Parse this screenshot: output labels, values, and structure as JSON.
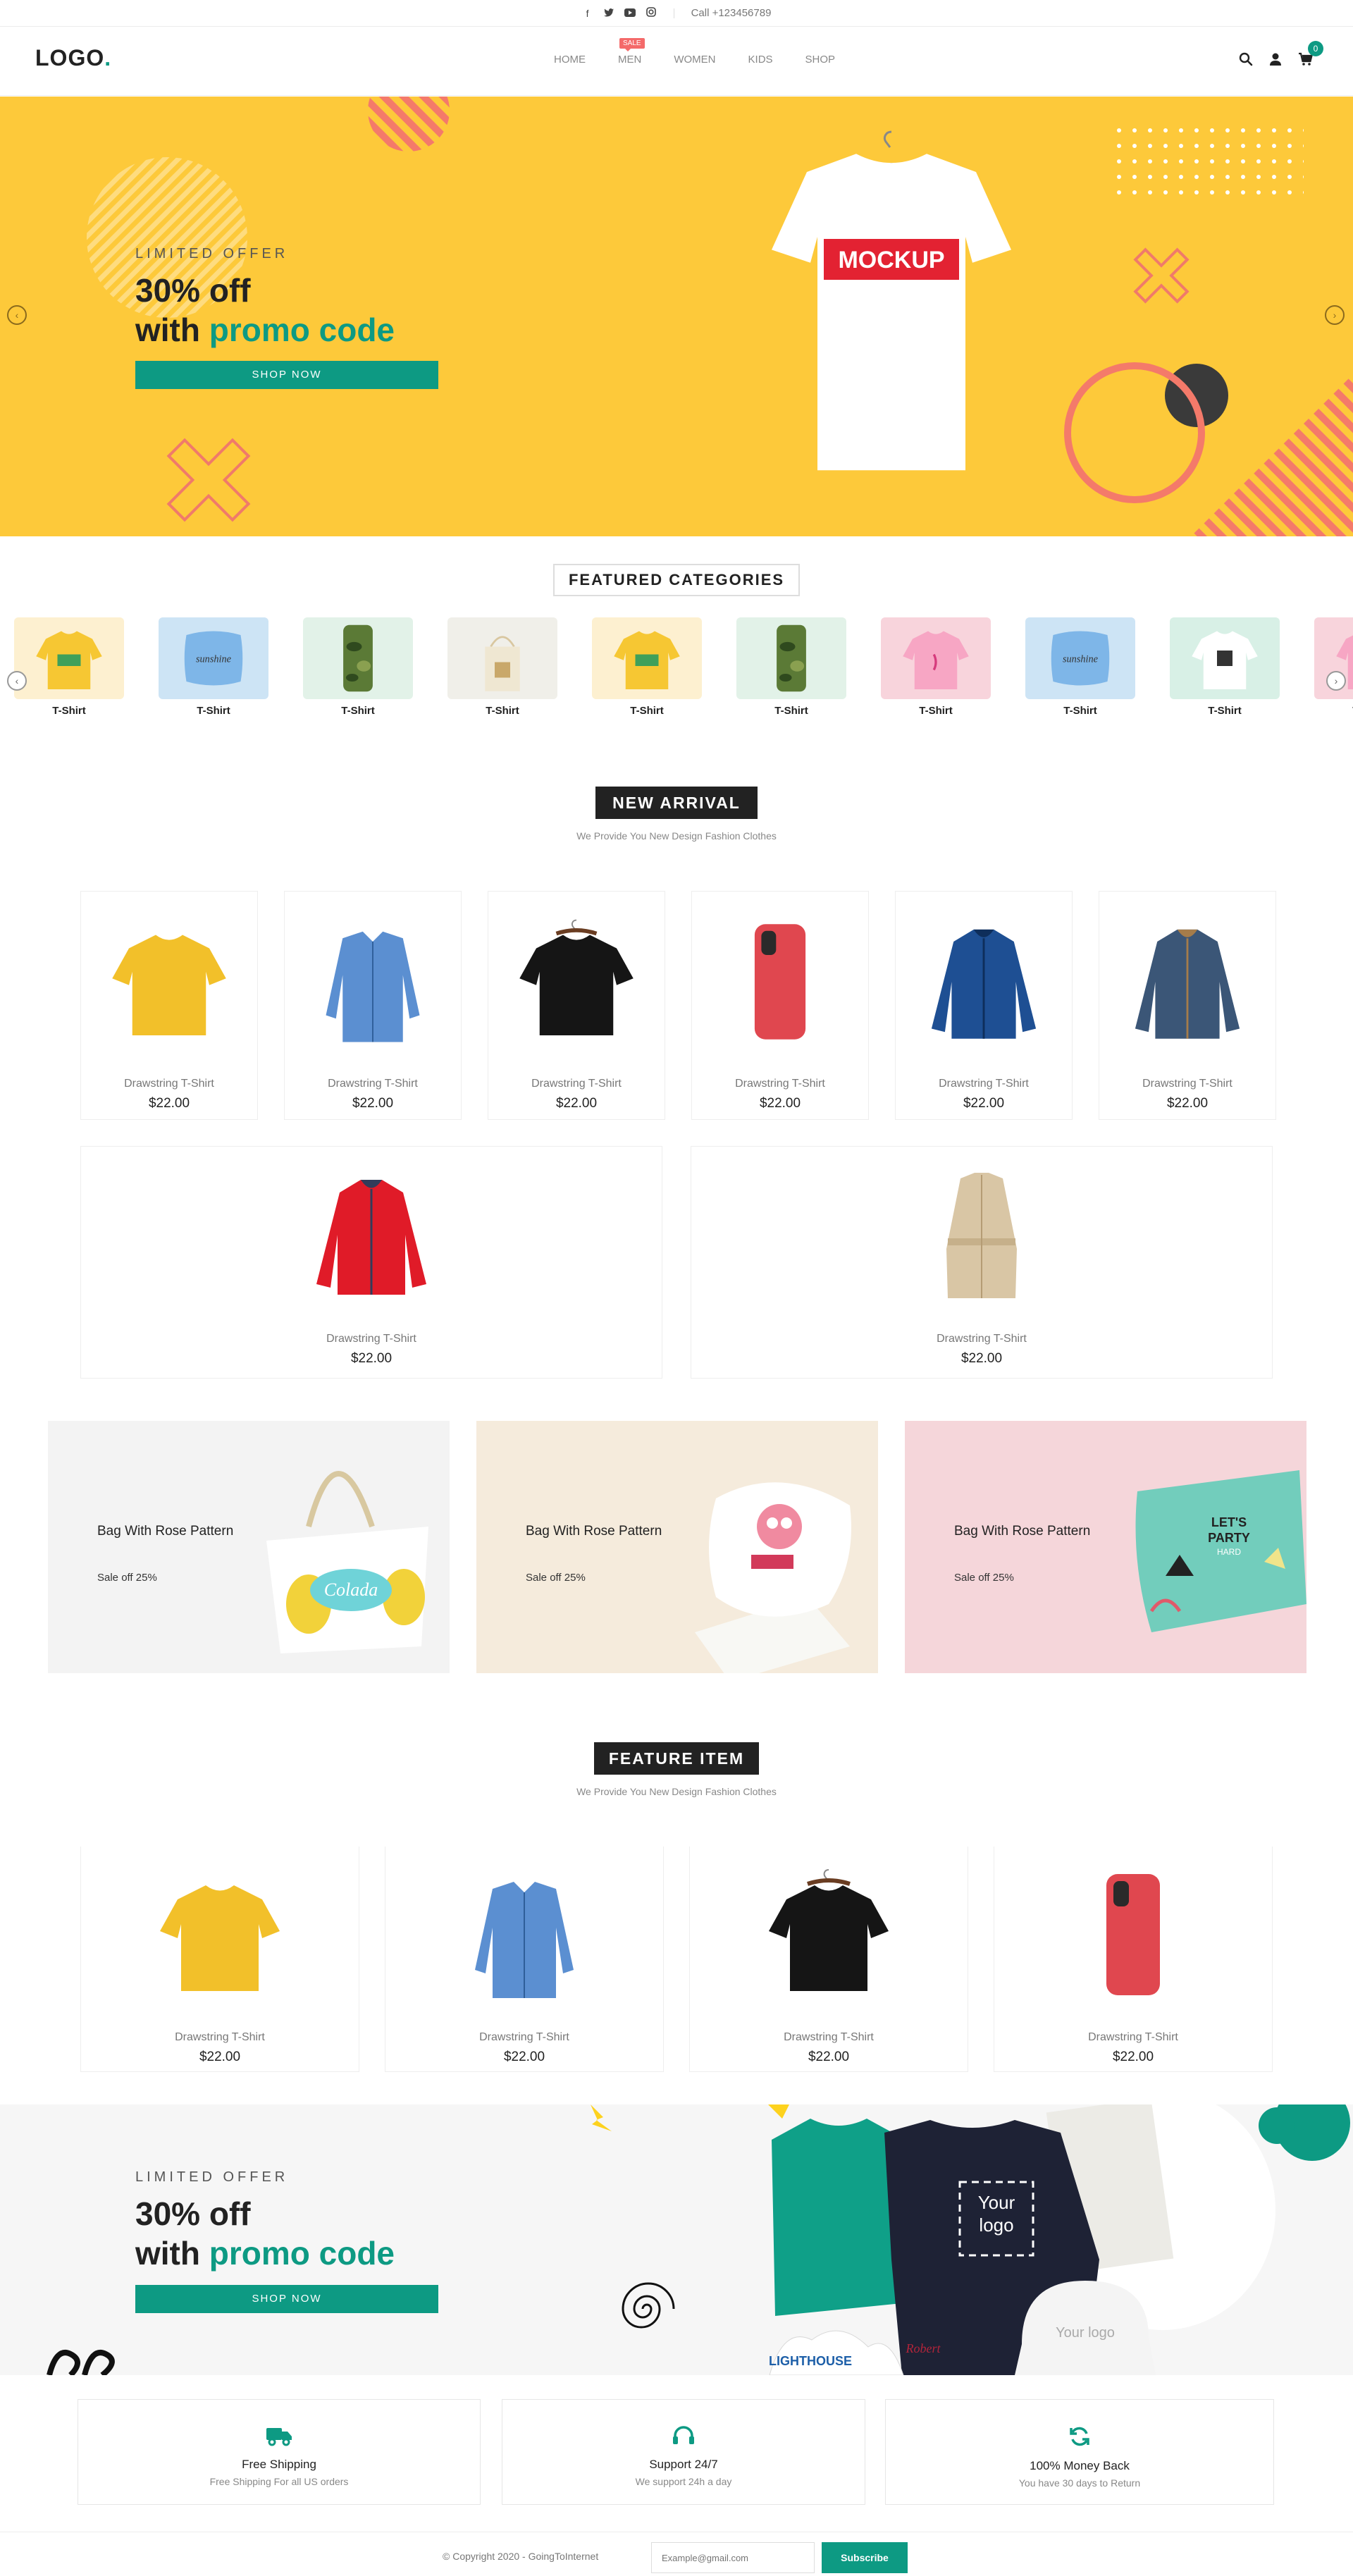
{
  "topbar": {
    "social_icons": [
      "facebook-icon",
      "twitter-icon",
      "youtube-icon",
      "instagram-icon"
    ],
    "phone": "Call +123456789"
  },
  "header": {
    "logo": "LOGO",
    "logo_dot": ".",
    "nav": [
      {
        "label": "HOME"
      },
      {
        "label": "MEN",
        "badge": "SALE"
      },
      {
        "label": "WOMEN"
      },
      {
        "label": "KIDS"
      },
      {
        "label": "SHOP"
      }
    ],
    "cart_count": "0"
  },
  "hero": {
    "kicker": "LIMITED OFFER",
    "line1": "30% off",
    "line2_prefix": "with ",
    "line2_accent": "promo code",
    "button": "SHOP NOW",
    "mockup_text": "MOCKUP"
  },
  "featured": {
    "title": "FEATURED CATEGORIES",
    "items": [
      {
        "label": "T-Shirt",
        "bg": "#fdf0d0",
        "kind": "tshirt-yellow"
      },
      {
        "label": "T-Shirt",
        "bg": "#cde4f5",
        "kind": "pillow-blue"
      },
      {
        "label": "T-Shirt",
        "bg": "#e2f2e8",
        "kind": "phone-camo"
      },
      {
        "label": "T-Shirt",
        "bg": "#f0efe9",
        "kind": "tote"
      },
      {
        "label": "T-Shirt",
        "bg": "#fdf0d0",
        "kind": "tshirt-yellow"
      },
      {
        "label": "T-Shirt",
        "bg": "#e2f2e8",
        "kind": "phone-camo"
      },
      {
        "label": "T-Shirt",
        "bg": "#f8d4dc",
        "kind": "tshirt-pink"
      },
      {
        "label": "T-Shirt",
        "bg": "#cde4f5",
        "kind": "pillow-blue"
      },
      {
        "label": "T-Shirt",
        "bg": "#d8f0e6",
        "kind": "tshirt-white"
      },
      {
        "label": "T-Shirt",
        "bg": "#f8d4dc",
        "kind": "tshirt-pink"
      }
    ]
  },
  "new_arrival": {
    "title": "NEW ARRIVAL",
    "subtitle": "We Provide You New Design Fashion Clothes",
    "products": [
      {
        "name": "Drawstring T-Shirt",
        "price": "$22.00",
        "kind": "tee-yellow"
      },
      {
        "name": "Drawstring T-Shirt",
        "price": "$22.00",
        "kind": "shirt-blue"
      },
      {
        "name": "Drawstring T-Shirt",
        "price": "$22.00",
        "kind": "tee-black"
      },
      {
        "name": "Drawstring T-Shirt",
        "price": "$22.00",
        "kind": "phone-red"
      },
      {
        "name": "Drawstring T-Shirt",
        "price": "$22.00",
        "kind": "jacket-blue"
      },
      {
        "name": "Drawstring T-Shirt",
        "price": "$22.00",
        "kind": "jacket-denim"
      },
      {
        "name": "Drawstring T-Shirt",
        "price": "$22.00",
        "kind": "jacket-red"
      },
      {
        "name": "Drawstring T-Shirt",
        "price": "$22.00",
        "kind": "coat-beige"
      }
    ]
  },
  "promos": [
    {
      "title": "Bag With Rose Pattern",
      "subtitle": "Sale off 25%",
      "bg": "#f3f3f3",
      "kind": "bag"
    },
    {
      "title": "Bag With Rose Pattern",
      "subtitle": "Sale off 25%",
      "bg": "#f5ebdc",
      "kind": "pillow-white"
    },
    {
      "title": "Bag With Rose Pattern",
      "subtitle": "Sale off 25%",
      "bg": "#f5d6da",
      "kind": "pillow-teal"
    }
  ],
  "feature_item": {
    "title": "FEATURE ITEM",
    "subtitle": "We Provide You New Design Fashion Clothes",
    "products": [
      {
        "name": "Drawstring T-Shirt",
        "price": "$22.00",
        "kind": "tee-yellow"
      },
      {
        "name": "Drawstring T-Shirt",
        "price": "$22.00",
        "kind": "shirt-blue"
      },
      {
        "name": "Drawstring T-Shirt",
        "price": "$22.00",
        "kind": "tee-black"
      },
      {
        "name": "Drawstring T-Shirt",
        "price": "$22.00",
        "kind": "phone-red"
      }
    ]
  },
  "offer2": {
    "kicker": "LIMITED OFFER",
    "line1": "30% off",
    "line2_prefix": "with ",
    "line2_accent": "promo code",
    "button": "SHOP NOW",
    "logo_placeholder": "Your logo",
    "cap_logo": "Your logo"
  },
  "services": [
    {
      "icon": "truck-icon",
      "title": "Free Shipping",
      "desc": "Free Shipping For all US orders"
    },
    {
      "icon": "headset-icon",
      "title": "Support 24/7",
      "desc": "We support 24h a day"
    },
    {
      "icon": "refresh-icon",
      "title": "100% Money Back",
      "desc": "You have 30 days to Return"
    }
  ],
  "footer": {
    "copyright": "© Copyright 2020 - GoingToInternet",
    "email_placeholder": "Example@gmail.com",
    "subscribe": "Subscribe"
  },
  "colors": {
    "accent": "#0d9a83",
    "hero_bg": "#fdc93a",
    "sale_badge": "#f46a6a"
  }
}
